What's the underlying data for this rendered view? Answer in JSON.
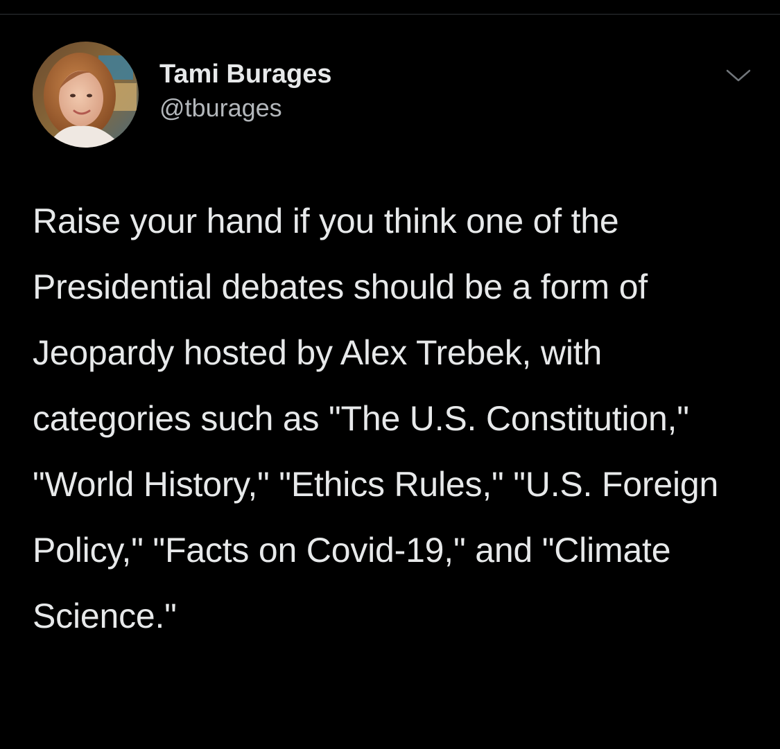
{
  "tweet": {
    "author": {
      "display_name": "Tami Burages",
      "handle": "@tburages",
      "avatar": "avatar-photo"
    },
    "menu_icon": "chevron-down-icon",
    "text": "Raise your hand if you think one of the Presidential debates should be a form of Jeopardy hosted by Alex Trebek, with categories such as \"The U.S. Constitution,\" \"World History,\" \"Ethics Rules,\" \"U.S. Foreign Policy,\" \"Facts on Covid-19,\" and \"Climate Science.\""
  },
  "theme": {
    "background": "#000000",
    "text": "#e7e9ea",
    "secondary_text": "#b3b7bb",
    "divider": "#2f3336"
  }
}
